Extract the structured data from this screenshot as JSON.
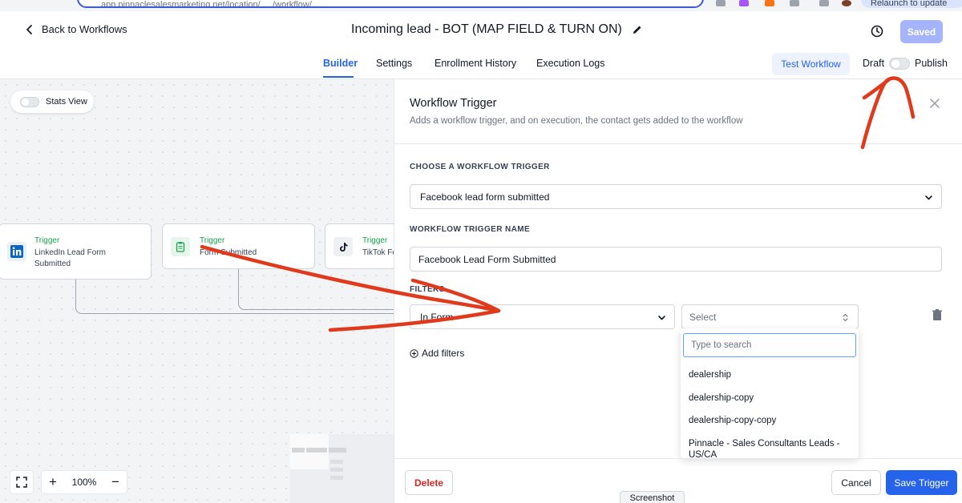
{
  "browser": {
    "url": "app.pinnaclesalesmarketing.net/location/...../workflow/.....",
    "relaunch_label": "Relaunch to update"
  },
  "header": {
    "back_label": "Back to Workflows",
    "title": "Incoming lead - BOT (MAP FIELD & TURN ON)",
    "saved_label": "Saved"
  },
  "tabs": [
    {
      "label": "Builder",
      "active": true
    },
    {
      "label": "Settings"
    },
    {
      "label": "Enrollment History"
    },
    {
      "label": "Execution Logs"
    }
  ],
  "toolbar": {
    "test_label": "Test Workflow",
    "draft_label": "Draft",
    "publish_label": "Publish"
  },
  "canvas": {
    "stats_label": "Stats View",
    "nodes": [
      {
        "kind": "Trigger",
        "label": "LinkedIn Lead Form Submitted",
        "icon": "linkedin-icon"
      },
      {
        "kind": "Trigger",
        "label": "Form Submitted",
        "icon": "clipboard-icon"
      },
      {
        "kind": "Trigger",
        "label": "TikTok Form Submitted",
        "icon": "tiktok-icon"
      }
    ],
    "zoom_level": "100%"
  },
  "panel": {
    "title": "Workflow Trigger",
    "subtitle": "Adds a workflow trigger, and on execution, the contact gets added to the workflow",
    "choose_label": "CHOOSE A WORKFLOW TRIGGER",
    "trigger_value": "Facebook lead form submitted",
    "name_label": "WORKFLOW TRIGGER NAME",
    "name_value": "Facebook Lead Form Submitted",
    "filters_label": "FILTERS",
    "filter_field": "In Form",
    "filter_value_placeholder": "Select",
    "add_filters_label": "Add filters",
    "dropdown": {
      "search_placeholder": "Type to search",
      "options": [
        "dealership",
        "dealership-copy",
        "dealership-copy-copy",
        "Pinnacle - Sales Consultants Leads - US/CA"
      ]
    },
    "delete_label": "Delete",
    "cancel_label": "Cancel",
    "save_label": "Save Trigger"
  },
  "tooltip": {
    "label": "Screenshot"
  },
  "colors": {
    "accent": "#2563eb",
    "trigger_green": "#16a34a",
    "annotation_red": "#e0391c",
    "danger": "#dc2626"
  }
}
